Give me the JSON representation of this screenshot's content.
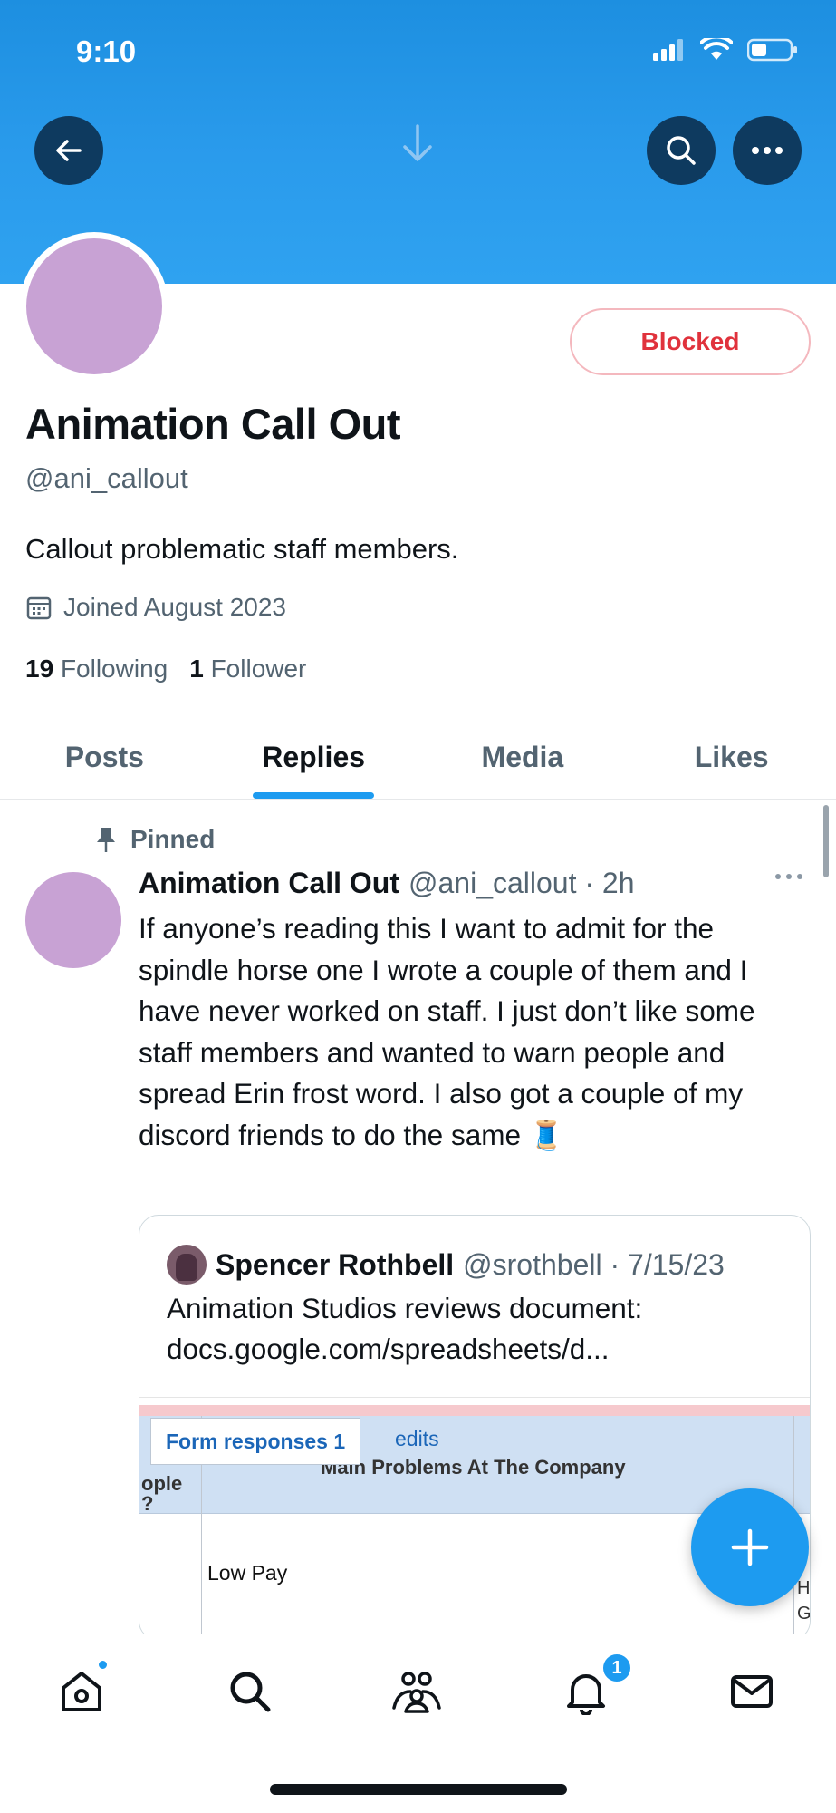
{
  "status_bar": {
    "time": "9:10"
  },
  "profile": {
    "display_name": "Animation Call Out",
    "handle": "@ani_callout",
    "bio": "Callout problematic staff members.",
    "joined": "Joined August 2023",
    "following_count": "19",
    "following_label": "Following",
    "followers_count": "1",
    "followers_label": "Follower",
    "blocked_label": "Blocked",
    "avatar_color": "#c8a2d4"
  },
  "tabs": [
    {
      "label": "Posts",
      "active": false
    },
    {
      "label": "Replies",
      "active": true
    },
    {
      "label": "Media",
      "active": false
    },
    {
      "label": "Likes",
      "active": false
    }
  ],
  "post": {
    "pinned_label": "Pinned",
    "author_name": "Animation Call Out",
    "author_meta": "@ani_callout · 2h",
    "text": "If anyone’s reading this I want to admit for the spindle horse one I wrote a couple of them and I have never worked on staff. I just don’t like some staff members and wanted to warn people and spread Erin frost word. I also got a couple of my discord friends to do the same 🧵",
    "quote": {
      "author_name": "Spencer Rothbell",
      "author_meta": "@srothbell · 7/15/23",
      "text": "Animation Studios reviews document: docs.google.com/spreadsheets/d...",
      "sheet": {
        "tab_label": "Form responses 1",
        "edits_label": "edits",
        "column_title": "Main Problems At The Company",
        "left_col_fragment": "ople\n?",
        "cell_value": "Low Pay",
        "right_fragment": "H\nG"
      }
    }
  },
  "nav": {
    "notification_count": "1"
  },
  "colors": {
    "accent": "#1d9bf0",
    "blocked": "#e0323c",
    "banner": "#2a9bec"
  }
}
